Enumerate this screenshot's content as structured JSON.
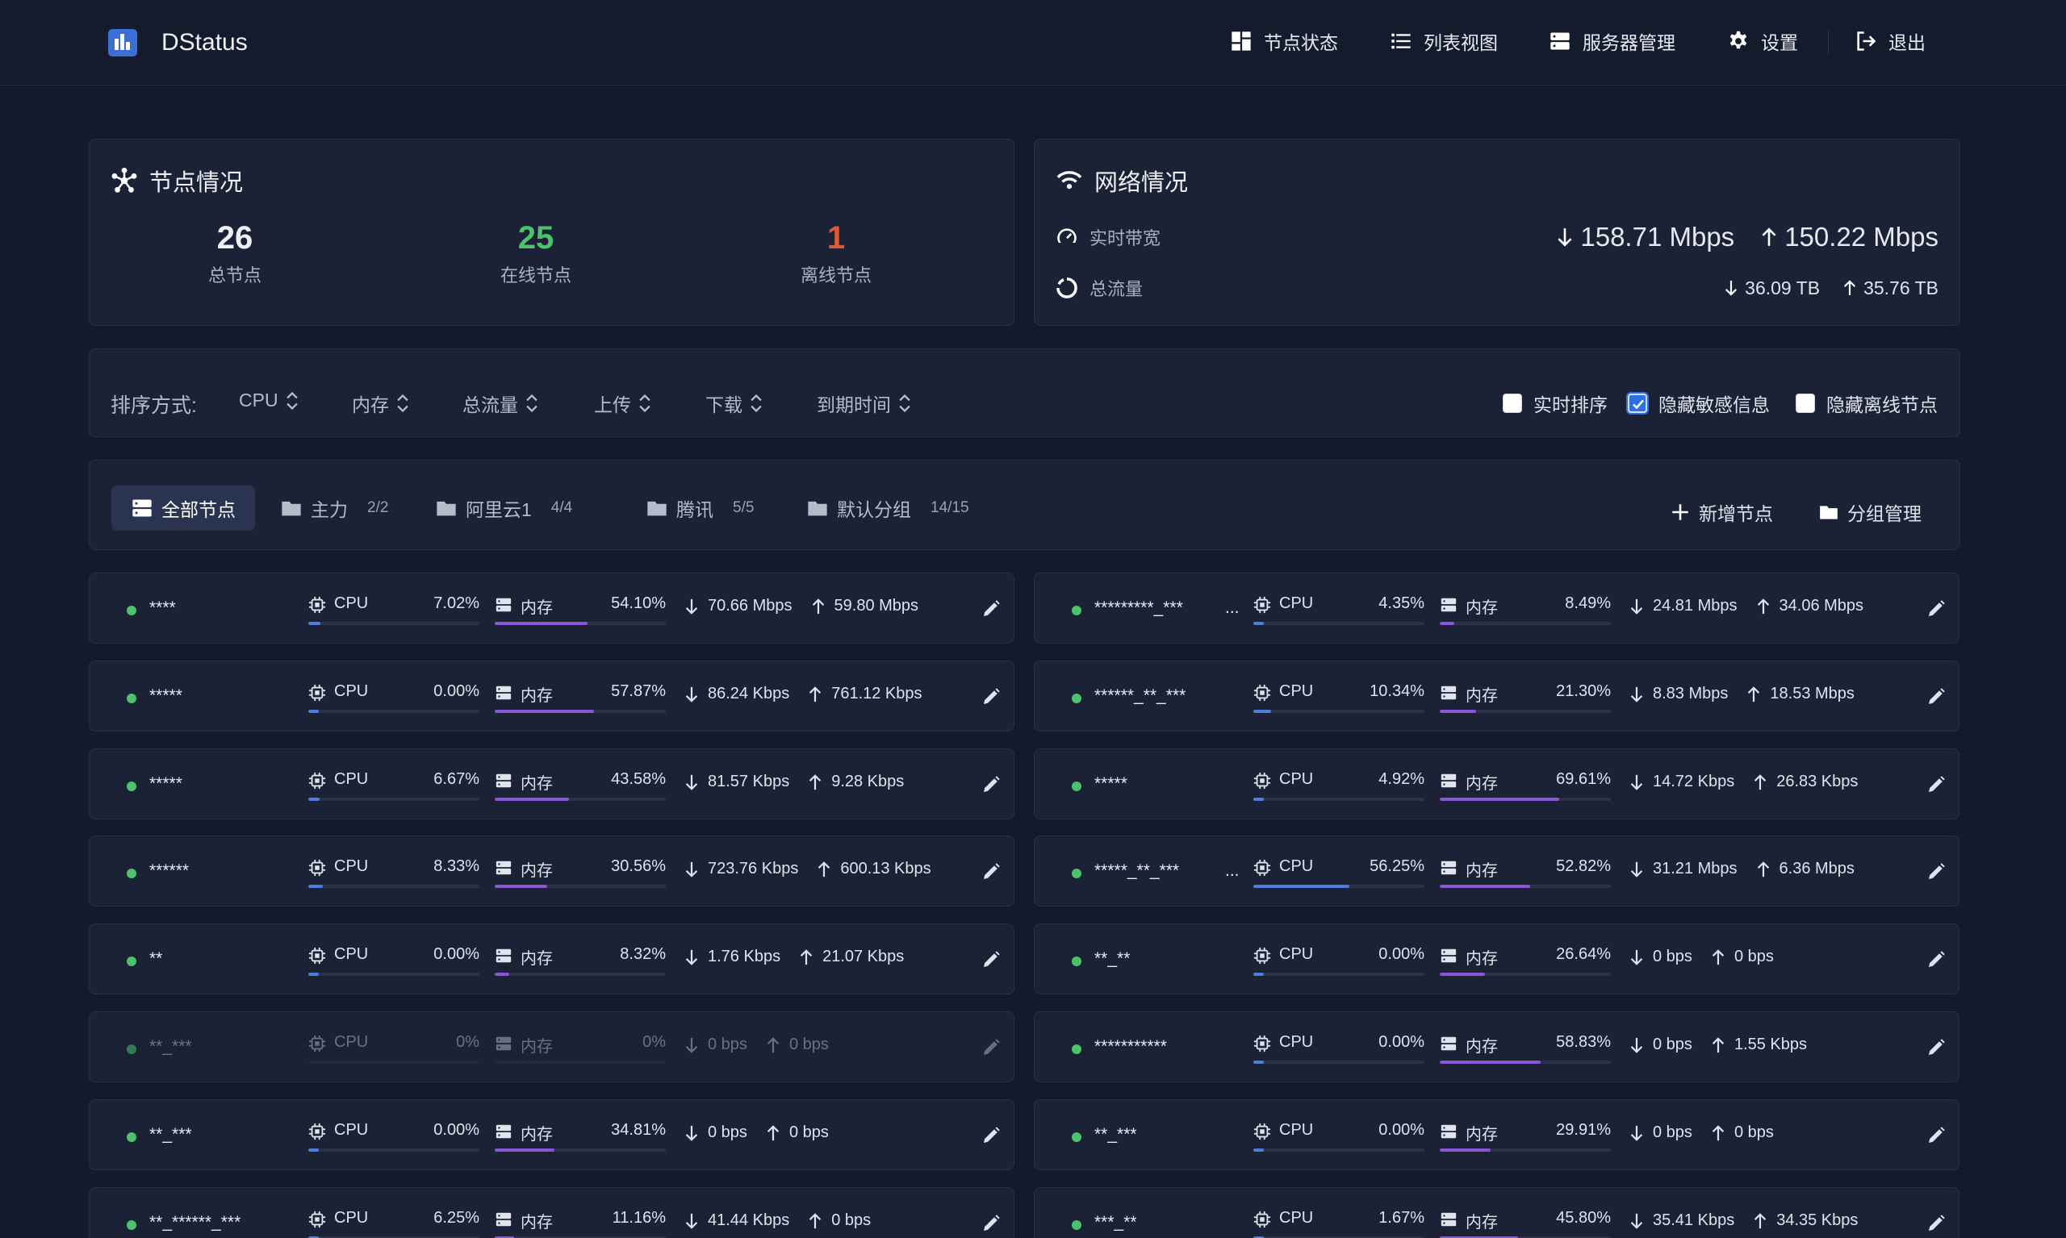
{
  "app": {
    "title": "DStatus"
  },
  "nav": {
    "status": "节点状态",
    "list": "列表视图",
    "servers": "服务器管理",
    "settings": "设置",
    "logout": "退出"
  },
  "nodes_overview": {
    "title": "节点情况",
    "total": "26",
    "total_label": "总节点",
    "online": "25",
    "online_label": "在线节点",
    "offline": "1",
    "offline_label": "离线节点"
  },
  "network": {
    "title": "网络情况",
    "bandwidth_label": "实时带宽",
    "bandwidth_down": "158.71 Mbps",
    "bandwidth_up": "150.22 Mbps",
    "traffic_label": "总流量",
    "traffic_down": "36.09 TB",
    "traffic_up": "35.76 TB"
  },
  "sort": {
    "label": "排序方式:",
    "options": [
      "CPU",
      "内存",
      "总流量",
      "上传",
      "下载",
      "到期时间"
    ],
    "realtime_label": "实时排序",
    "realtime_checked": false,
    "hide_sensitive_label": "隐藏敏感信息",
    "hide_sensitive_checked": true,
    "hide_offline_label": "隐藏离线节点",
    "hide_offline_checked": false
  },
  "groups": {
    "tabs": [
      {
        "label": "全部节点",
        "count": "",
        "active": true
      },
      {
        "label": "主力",
        "count": "2/2",
        "active": false
      },
      {
        "label": "阿里云1",
        "count": "4/4",
        "active": false
      },
      {
        "label": "腾讯",
        "count": "5/5",
        "active": false
      },
      {
        "label": "默认分组",
        "count": "14/15",
        "active": false
      }
    ],
    "add_node": "新增节点",
    "manage_groups": "分组管理"
  },
  "colors": {
    "cpu": "#4a7fe0",
    "mem": "#8a55d6",
    "online": "#4cc36b",
    "offline": "#e0583a",
    "accent": "#2f6fe6"
  },
  "cpu_label": "CPU",
  "mem_label": "内存",
  "node_rows": [
    [
      {
        "name": "****",
        "ellipsis": false,
        "cpu": "7.02%",
        "cpu_v": 0.0702,
        "mem": "54.10%",
        "mem_v": 0.541,
        "down": "70.66 Mbps",
        "up": "59.80 Mbps",
        "online": true
      },
      {
        "name": "*********_***",
        "ellipsis": true,
        "cpu": "4.35%",
        "cpu_v": 0.0435,
        "mem": "8.49%",
        "mem_v": 0.0849,
        "down": "24.81 Mbps",
        "up": "34.06 Mbps",
        "online": true
      }
    ],
    [
      {
        "name": "*****",
        "ellipsis": false,
        "cpu": "0.00%",
        "cpu_v": 0,
        "mem": "57.87%",
        "mem_v": 0.5787,
        "down": "86.24 Kbps",
        "up": "761.12 Kbps",
        "online": true
      },
      {
        "name": "******_**_***",
        "ellipsis": false,
        "cpu": "10.34%",
        "cpu_v": 0.1034,
        "mem": "21.30%",
        "mem_v": 0.213,
        "down": "8.83 Mbps",
        "up": "18.53 Mbps",
        "online": true
      }
    ],
    [
      {
        "name": "*****",
        "ellipsis": false,
        "cpu": "6.67%",
        "cpu_v": 0.0667,
        "mem": "43.58%",
        "mem_v": 0.4358,
        "down": "81.57 Kbps",
        "up": "9.28 Kbps",
        "online": true
      },
      {
        "name": "*****",
        "ellipsis": false,
        "cpu": "4.92%",
        "cpu_v": 0.0492,
        "mem": "69.61%",
        "mem_v": 0.6961,
        "down": "14.72 Kbps",
        "up": "26.83 Kbps",
        "online": true
      }
    ],
    [
      {
        "name": "******",
        "ellipsis": false,
        "cpu": "8.33%",
        "cpu_v": 0.0833,
        "mem": "30.56%",
        "mem_v": 0.3056,
        "down": "723.76 Kbps",
        "up": "600.13 Kbps",
        "online": true
      },
      {
        "name": "*****_**_***",
        "ellipsis": true,
        "cpu": "56.25%",
        "cpu_v": 0.5625,
        "mem": "52.82%",
        "mem_v": 0.5282,
        "down": "31.21 Mbps",
        "up": "6.36 Mbps",
        "online": true
      }
    ],
    [
      {
        "name": "**",
        "ellipsis": false,
        "cpu": "0.00%",
        "cpu_v": 0,
        "mem": "8.32%",
        "mem_v": 0.0832,
        "down": "1.76 Kbps",
        "up": "21.07 Kbps",
        "online": true
      },
      {
        "name": "**_**",
        "ellipsis": false,
        "cpu": "0.00%",
        "cpu_v": 0,
        "mem": "26.64%",
        "mem_v": 0.2664,
        "down": "0 bps",
        "up": "0 bps",
        "online": true
      }
    ],
    [
      {
        "name": "**_***",
        "ellipsis": false,
        "cpu": "0%",
        "cpu_v": 0,
        "mem": "0%",
        "mem_v": 0,
        "down": "0 bps",
        "up": "0 bps",
        "online": false
      },
      {
        "name": "***********",
        "ellipsis": false,
        "cpu": "0.00%",
        "cpu_v": 0,
        "mem": "58.83%",
        "mem_v": 0.5883,
        "down": "0 bps",
        "up": "1.55 Kbps",
        "online": true
      }
    ],
    [
      {
        "name": "**_***",
        "ellipsis": false,
        "cpu": "0.00%",
        "cpu_v": 0,
        "mem": "34.81%",
        "mem_v": 0.3481,
        "down": "0 bps",
        "up": "0 bps",
        "online": true
      },
      {
        "name": "**_***",
        "ellipsis": false,
        "cpu": "0.00%",
        "cpu_v": 0,
        "mem": "29.91%",
        "mem_v": 0.2991,
        "down": "0 bps",
        "up": "0 bps",
        "online": true
      }
    ],
    [
      {
        "name": "**_******_***",
        "ellipsis": false,
        "cpu": "6.25%",
        "cpu_v": 0.0625,
        "mem": "11.16%",
        "mem_v": 0.1116,
        "down": "41.44 Kbps",
        "up": "0 bps",
        "online": true
      },
      {
        "name": "***_**",
        "ellipsis": false,
        "cpu": "1.67%",
        "cpu_v": 0.0167,
        "mem": "45.80%",
        "mem_v": 0.458,
        "down": "35.41 Kbps",
        "up": "34.35 Kbps",
        "online": true
      }
    ]
  ]
}
